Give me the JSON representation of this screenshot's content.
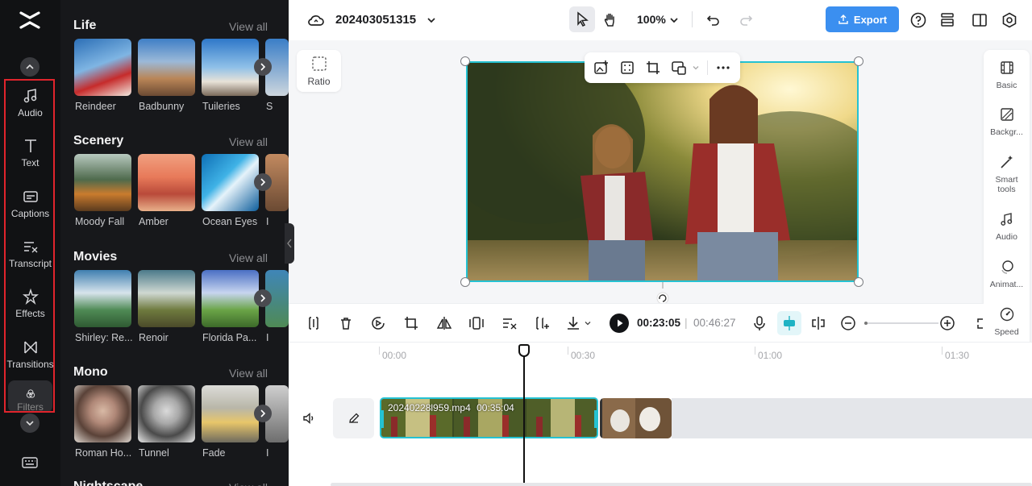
{
  "rail": {
    "items": [
      {
        "label": "Audio",
        "icon": "music-note-icon"
      },
      {
        "label": "Text",
        "icon": "text-icon"
      },
      {
        "label": "Captions",
        "icon": "captions-icon"
      },
      {
        "label": "Transcript",
        "icon": "transcript-icon"
      },
      {
        "label": "Effects",
        "icon": "effects-star-icon"
      },
      {
        "label": "Transitions",
        "icon": "transitions-icon"
      },
      {
        "label": "Filters",
        "icon": "filters-icon"
      }
    ]
  },
  "panel": {
    "view_all_label": "View all",
    "sections": [
      {
        "title": "Life",
        "items": [
          "Reindeer",
          "Badbunny",
          "Tuileries",
          "S"
        ]
      },
      {
        "title": "Scenery",
        "items": [
          "Moody Fall",
          "Amber",
          "Ocean Eyes",
          "I"
        ]
      },
      {
        "title": "Movies",
        "items": [
          "Shirley: Re...",
          "Renoir",
          "Florida Pa...",
          "I"
        ]
      },
      {
        "title": "Mono",
        "items": [
          "Roman Ho...",
          "Tunnel",
          "Fade",
          "I"
        ]
      },
      {
        "title": "Nightscape",
        "items": []
      }
    ]
  },
  "topbar": {
    "project_name": "202403051315",
    "zoom": "100%",
    "export_label": "Export"
  },
  "canvas": {
    "ratio_label": "Ratio"
  },
  "right_rail": {
    "items": [
      {
        "label": "Basic",
        "icon": "basic-film-icon"
      },
      {
        "label": "Backgr...",
        "icon": "background-icon"
      },
      {
        "label": "Smart tools",
        "icon": "magic-wand-icon"
      },
      {
        "label": "Audio",
        "icon": "music-note-icon"
      },
      {
        "label": "Animat...",
        "icon": "animation-icon"
      },
      {
        "label": "Speed",
        "icon": "speed-gauge-icon"
      }
    ]
  },
  "timeline": {
    "current_time": "00:23:05",
    "separator": "|",
    "total_time": "00:46:27",
    "ruler": [
      "00:00",
      "00:30",
      "01:00",
      "01:30"
    ],
    "clip_name": "20240228l959.mp4",
    "clip_duration": "00:35:04",
    "zoom_fraction": 0.0
  },
  "colors": {
    "accent": "#3b8ff0",
    "selection": "#25c2d2",
    "highlight_box": "#e0242c"
  }
}
